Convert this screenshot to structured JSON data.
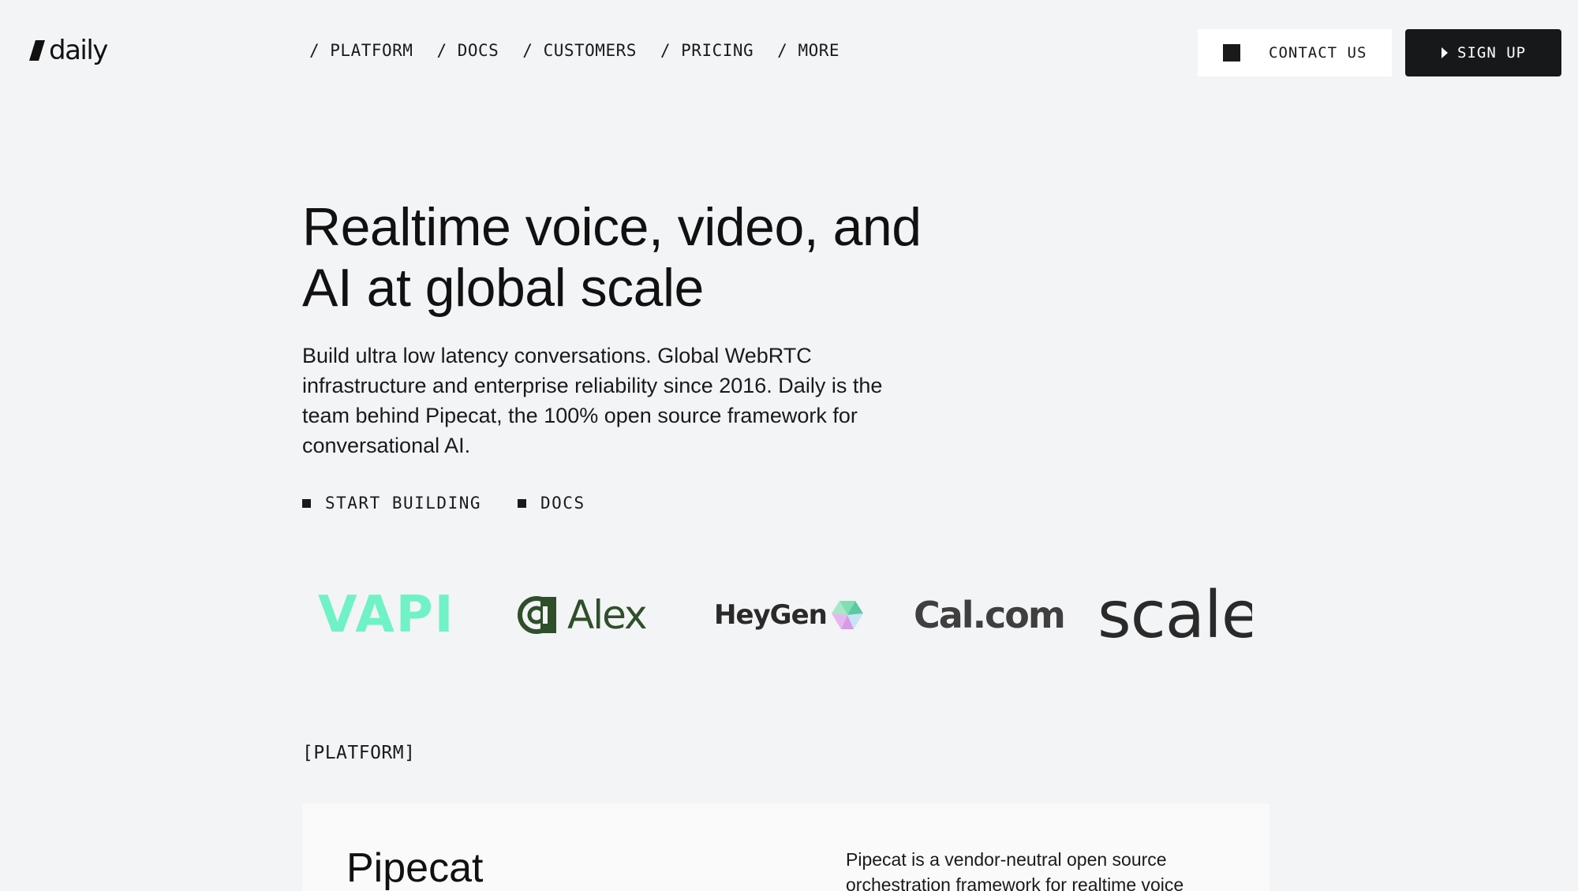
{
  "brand": {
    "name": "daily"
  },
  "nav": {
    "items": [
      {
        "label": "/ PLATFORM"
      },
      {
        "label": "/ DOCS"
      },
      {
        "label": "/ CUSTOMERS"
      },
      {
        "label": "/ PRICING"
      },
      {
        "label": "/ MORE"
      }
    ]
  },
  "header": {
    "contact_label": "CONTACT US",
    "signup_label": "SIGN UP"
  },
  "hero": {
    "title_line1": "Realtime voice, video, and",
    "title_line2": "AI at global scale",
    "subtitle": "Build ultra low latency conversations. Global WebRTC infrastructure and enterprise reliability since 2016. Daily is the team behind Pipecat, the 100% open source framework for conversational AI.",
    "cta_primary": "START BUILDING",
    "cta_secondary": "DOCS"
  },
  "customers": {
    "logos": [
      {
        "name": "VAPI",
        "text": "VAPI",
        "color": "#6ff2c6"
      },
      {
        "name": "Alex",
        "text": "Alex",
        "color": "#2f4f2a"
      },
      {
        "name": "HeyGen",
        "text": "HeyGen",
        "color": "#2a2a2a"
      },
      {
        "name": "Cal.com",
        "text": "Cal.com",
        "color": "#3f3f3f"
      },
      {
        "name": "Scale",
        "text": "scale",
        "color": "#2a2a2a"
      }
    ]
  },
  "platform": {
    "section_label": "[PLATFORM]",
    "card_title": "Pipecat",
    "card_description": "Pipecat is a vendor-neutral open source orchestration framework for realtime voice"
  },
  "colors": {
    "background": "#f3f4f6",
    "text": "#1a1a1a",
    "dark_button": "#17181a",
    "card": "#fafafa"
  }
}
